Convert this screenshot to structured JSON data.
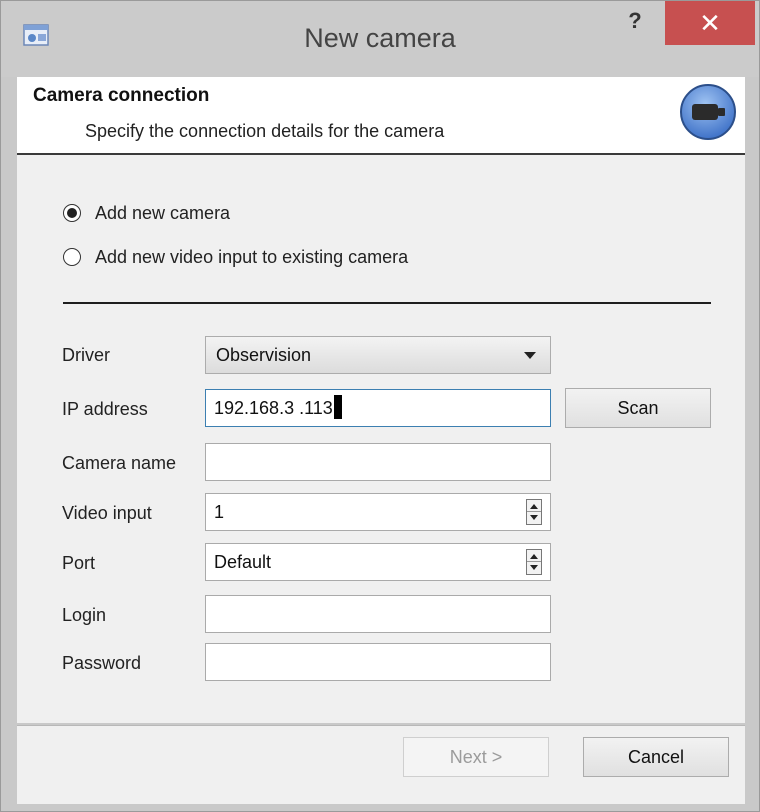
{
  "window": {
    "title": "New camera",
    "help_label": "?",
    "close_label": "✕",
    "app_icon": "camera-app-icon"
  },
  "header": {
    "title": "Camera connection",
    "subtitle": "Specify the connection details for the camera",
    "icon": "camera-icon"
  },
  "mode": {
    "options": [
      {
        "label": "Add new camera",
        "selected": true
      },
      {
        "label": "Add new video input to existing camera",
        "selected": false
      }
    ]
  },
  "form": {
    "driver": {
      "label": "Driver",
      "value": "Observision"
    },
    "ip_address": {
      "label": "IP address",
      "value": "192.168.3 .113"
    },
    "camera_name": {
      "label": "Camera name",
      "value": ""
    },
    "video_input": {
      "label": "Video input",
      "value": "1"
    },
    "port": {
      "label": "Port",
      "value": "Default"
    },
    "login": {
      "label": "Login",
      "value": ""
    },
    "password": {
      "label": "Password",
      "value": ""
    },
    "scan_label": "Scan"
  },
  "footer": {
    "next_label": "Next >",
    "cancel_label": "Cancel"
  },
  "colors": {
    "close_button": "#c75050",
    "focus_border": "#3c7fb1",
    "camera_icon_blue": "#4a7fd4"
  }
}
